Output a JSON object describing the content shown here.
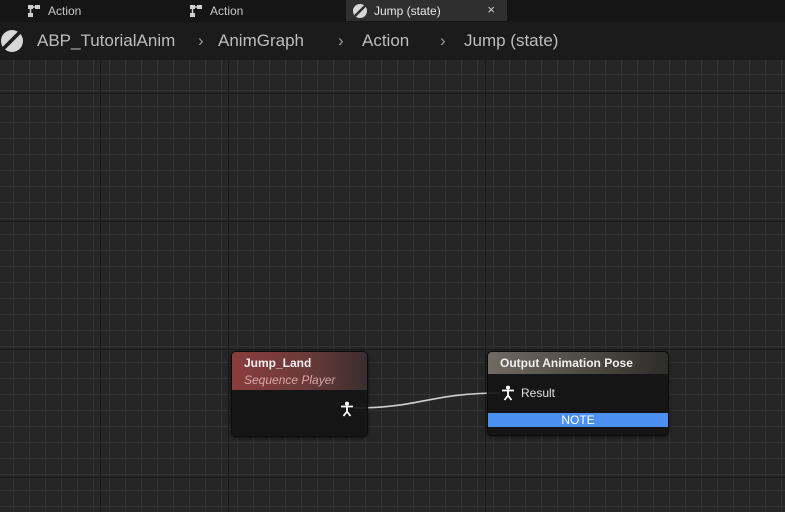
{
  "tabs": [
    {
      "label": "Action",
      "icon": "state-machine-icon",
      "active": false
    },
    {
      "label": "Action",
      "icon": "state-machine-icon",
      "active": false
    },
    {
      "label": "Jump (state)",
      "icon": "anim-state-icon",
      "active": true,
      "close": "×"
    }
  ],
  "breadcrumb": {
    "icon": "anim-blueprint-icon",
    "items": [
      "ABP_TutorialAnim",
      "AnimGraph",
      "Action",
      "Jump (state)"
    ],
    "separator": "›"
  },
  "nodes": {
    "jump_land": {
      "title": "Jump_Land",
      "subtitle": "Sequence Player",
      "output_pin_icon": "pose-pin-icon"
    },
    "output_pose": {
      "title": "Output Animation Pose",
      "result_label": "Result",
      "input_pin_icon": "pose-pin-icon",
      "note_label": "NOTE"
    }
  },
  "colors": {
    "accent_note": "#4b8ff0",
    "sequence_player_header": "#8a3d3d",
    "output_pose_header": "#6f6a62",
    "graph_background": "#262626"
  }
}
